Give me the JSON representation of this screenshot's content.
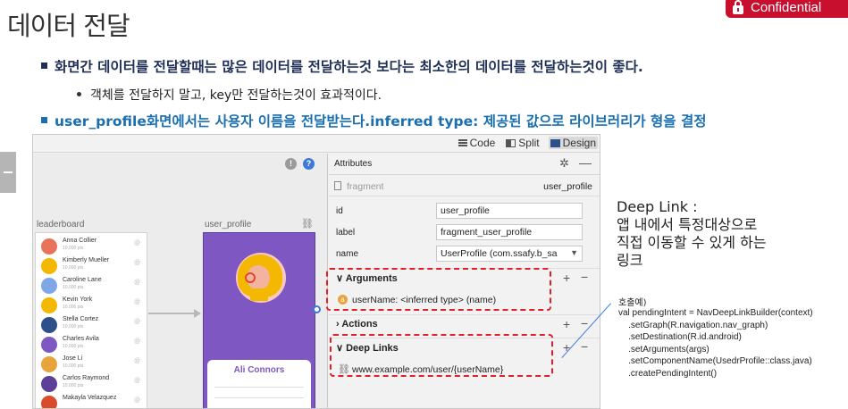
{
  "slide": {
    "title": "데이터 전달",
    "badge_label": "Confidential",
    "bullet1": "화면간 데이터를 전달할때는 많은 데이터를 전달하는것 보다는 최소한의 데이터를 전달하는것이 좋다.",
    "bullet2": "객체를 전달하지 말고, key만 전달하는것이 효과적이다.",
    "bullet3": "user_profile화면에서는 사용자 이름을 전달받는다.inferred type: 제공된 값으로 라이브러리가 형을 결정"
  },
  "studio": {
    "modes": [
      {
        "label": "Code",
        "icon": "lines-icon"
      },
      {
        "label": "Split",
        "icon": "split-icon"
      },
      {
        "label": "Design",
        "icon": "design-icon",
        "active": true
      }
    ],
    "canvas": {
      "leaderboard_label": "leaderboard",
      "user_profile_label": "user_profile",
      "leaderboard_rows": [
        {
          "name": "Anna Collier",
          "sub": "10,000 pts",
          "color": "#e8735a"
        },
        {
          "name": "Kimberly Mueller",
          "sub": "10,000 pts",
          "color": "#f5b800"
        },
        {
          "name": "Caroline Lane",
          "sub": "10,000 pts",
          "color": "#7fa7e8"
        },
        {
          "name": "Kevin York",
          "sub": "10,000 pts",
          "color": "#f5b800"
        },
        {
          "name": "Stella Cortez",
          "sub": "10,000 pts",
          "color": "#2d4f8a"
        },
        {
          "name": "Charles Avila",
          "sub": "10,000 pts",
          "color": "#7e57c2"
        },
        {
          "name": "Jose Li",
          "sub": "10,000 pts",
          "color": "#e8a33d"
        },
        {
          "name": "Carlos Raymond",
          "sub": "10,000 pts",
          "color": "#5c3f99"
        },
        {
          "name": "Makayla Velazquez",
          "sub": "",
          "color": "#d94b2b"
        }
      ],
      "profile_card_name": "Ali Connors"
    },
    "attributes": {
      "title": "Attributes",
      "fragment_label": "fragment",
      "fragment_value": "user_profile",
      "fields": [
        {
          "key": "id",
          "value": "user_profile"
        },
        {
          "key": "label",
          "value": "fragment_user_profile"
        },
        {
          "key": "name",
          "value": "UserProfile (com.ssafy.b_sa"
        }
      ],
      "arguments_title": "Arguments",
      "argument": "userName: <inferred type> (name)",
      "actions_title": "Actions",
      "deeplinks_title": "Deep Links",
      "deeplink": "www.example.com/user/{userName}"
    }
  },
  "annotation": {
    "deeplink_text": "Deep Link :\n앱 내에서 특정대상으로\n직접 이동할 수 있게 하는\n링크",
    "call_label": "호출예)",
    "code": "val pendingIntent = NavDeepLinkBuilder(context)\n    .setGraph(R.navigation.nav_graph)\n    .setDestination(R.id.android)\n    .setArguments(args)\n    .setComponentName(UsedrProfile::class.java)\n    .createPendingIntent()"
  },
  "colors": {
    "brand_red": "#c8102e",
    "heading_navy": "#1f2f56",
    "heading_blue": "#1a6fb0",
    "dash_red": "#e0202a",
    "profile_purple": "#7e57c2"
  }
}
